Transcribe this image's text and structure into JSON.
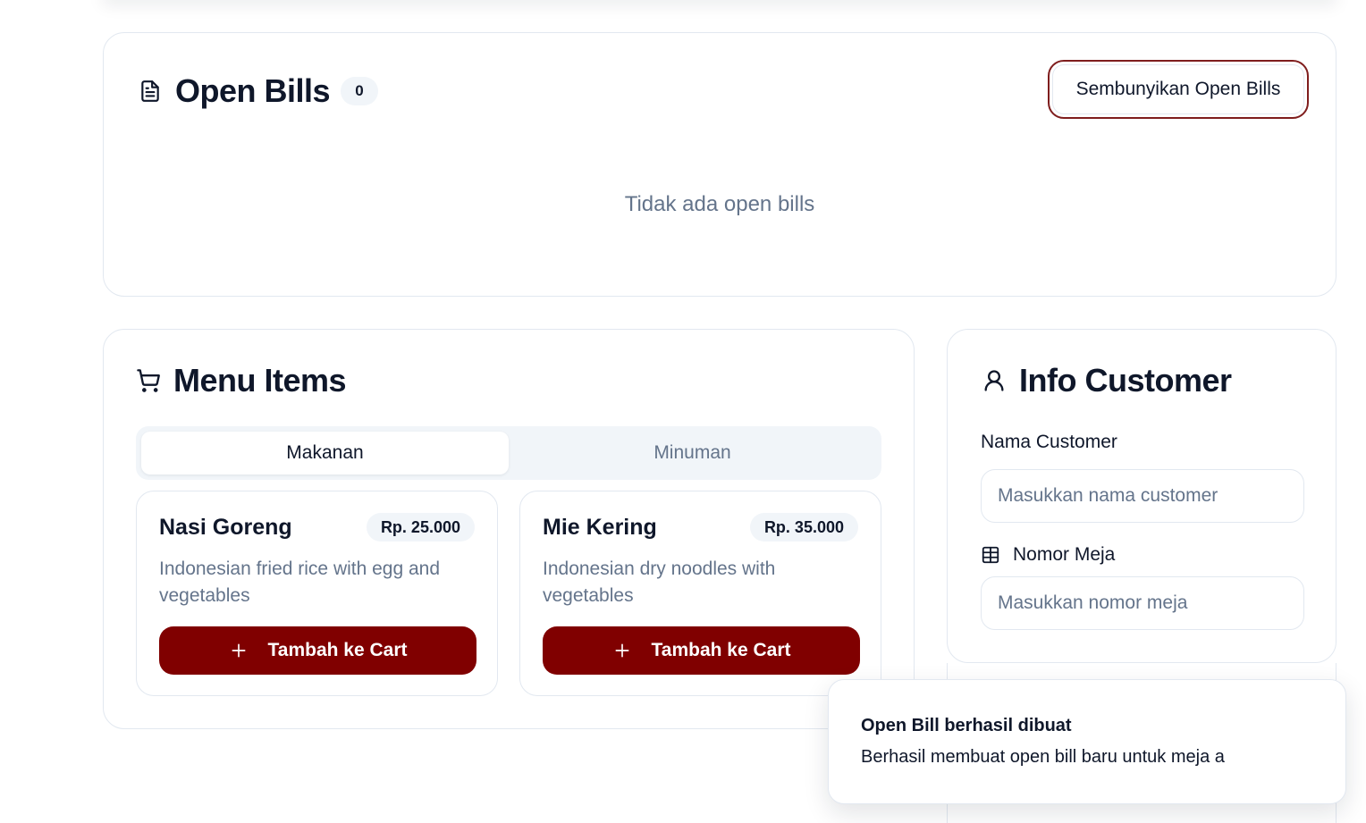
{
  "open_bills": {
    "title": "Open Bills",
    "count": "0",
    "toggle_label": "Sembunyikan Open Bills",
    "empty_text": "Tidak ada open bills"
  },
  "menu": {
    "title": "Menu Items",
    "tabs": [
      {
        "label": "Makanan",
        "active": true
      },
      {
        "label": "Minuman",
        "active": false
      }
    ],
    "items": [
      {
        "name": "Nasi Goreng",
        "price": "Rp. 25.000",
        "description": "Indonesian fried rice with egg and vegetables",
        "button_label": "Tambah ke Cart"
      },
      {
        "name": "Mie Kering",
        "price": "Rp. 35.000",
        "description": "Indonesian dry noodles with vegetables",
        "button_label": "Tambah ke Cart"
      }
    ]
  },
  "customer": {
    "title": "Info Customer",
    "name_label": "Nama Customer",
    "name_placeholder": "Masukkan nama customer",
    "name_value": "",
    "table_label": "Nomor Meja",
    "table_placeholder": "Masukkan nomor meja",
    "table_value": ""
  },
  "toast": {
    "title": "Open Bill berhasil dibuat",
    "description": "Berhasil membuat open bill baru untuk meja a"
  },
  "colors": {
    "accent": "#800000",
    "accent_border": "#7f1d1d",
    "muted_text": "#64748b",
    "border": "#e2e8f0",
    "badge_bg": "#f1f5f9"
  },
  "icons": {
    "open_bills": "file-text-icon",
    "menu": "shopping-cart-icon",
    "customer": "user-icon",
    "table": "table-grid-icon",
    "add": "plus-icon"
  }
}
